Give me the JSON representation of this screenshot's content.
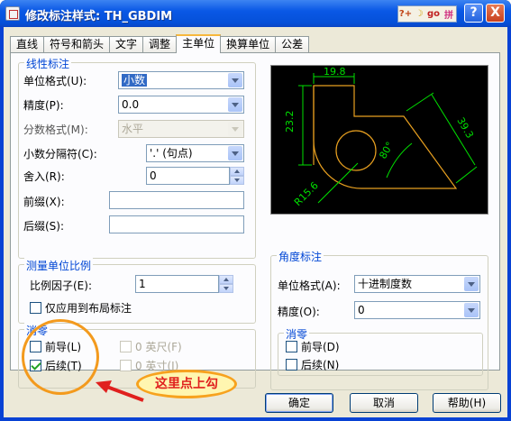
{
  "window": {
    "title": "修改标注样式: TH_GBDIM",
    "tools": [
      "?+",
      "☽",
      "go",
      "拼"
    ],
    "help_btn": "?",
    "close_btn": "X"
  },
  "tabs": [
    "直线",
    "符号和箭头",
    "文字",
    "调整",
    "主单位",
    "换算单位",
    "公差"
  ],
  "active_tab": "主单位",
  "linear": {
    "title": "线性标注",
    "unit_format_label": "单位格式(U):",
    "unit_format_value": "小数",
    "precision_label": "精度(P):",
    "precision_value": "0.0",
    "fraction_label": "分数格式(M):",
    "fraction_value": "水平",
    "decimal_sep_label": "小数分隔符(C):",
    "decimal_sep_value": "'.' (句点)",
    "roundoff_label": "舍入(R):",
    "roundoff_value": "0",
    "prefix_label": "前缀(X):",
    "prefix_value": "",
    "suffix_label": "后缀(S):",
    "suffix_value": ""
  },
  "scale": {
    "title": "测量单位比例",
    "factor_label": "比例因子(E):",
    "factor_value": "1",
    "layout_only_label": "仅应用到布局标注"
  },
  "zero_linear": {
    "title": "消零",
    "leading_label": "前导(L)",
    "leading_checked": false,
    "trailing_label": "后续(T)",
    "trailing_checked": true,
    "feet_label": "0 英尺(F)",
    "inches_label": "0 英寸(I)"
  },
  "preview": {
    "dim_top": "19.8",
    "dim_left": "23.2",
    "dim_right": "39.3",
    "dim_angle": "80°",
    "dim_radius": "R15.6"
  },
  "angular": {
    "title": "角度标注",
    "unit_format_label": "单位格式(A):",
    "unit_format_value": "十进制度数",
    "precision_label": "精度(O):",
    "precision_value": "0"
  },
  "zero_angular": {
    "title": "消零",
    "leading_label": "前导(D)",
    "leading_checked": false,
    "trailing_label": "后续(N)",
    "trailing_checked": false
  },
  "buttons": {
    "ok": "确定",
    "cancel": "取消",
    "help": "帮助(H)"
  },
  "annotation": {
    "callout": "这里点上勾"
  },
  "colors": {
    "title_blue": "#0a58e6",
    "group_title": "#0046d5",
    "preview_bg": "#000000",
    "geometry": "#e8a020",
    "dims": "#00e000",
    "annotation": "#f39a1d",
    "callout_text": "#e0201e"
  }
}
